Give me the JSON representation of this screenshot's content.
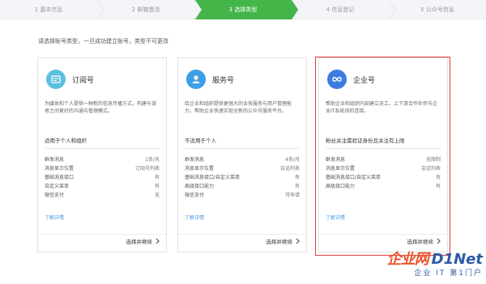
{
  "stepper": {
    "steps": [
      {
        "label": "1 基本信息"
      },
      {
        "label": "2 邮箱激活"
      },
      {
        "label": "3 选择类型"
      },
      {
        "label": "4 信息登记"
      },
      {
        "label": "5 公众号信息"
      }
    ],
    "active_index": 2
  },
  "instruction": "请选择账号类型，一旦成功建立账号，类型不可更改",
  "cards": [
    {
      "title": "订阅号",
      "icon": "subscription-icon",
      "icon_color": "#5bc0de",
      "desc": "为媒体和个人提供一种新的信息传播方式，构建与读者之间更好的沟通与管理模式。",
      "audience": "适用于个人和组织",
      "features": [
        {
          "label": "群发消息",
          "value": "1条/天"
        },
        {
          "label": "消息显示位置",
          "value": "订阅号列表"
        },
        {
          "label": "基础消息接口",
          "value": "有"
        },
        {
          "label": "自定义菜单",
          "value": "有"
        },
        {
          "label": "微信支付",
          "value": "无"
        }
      ],
      "more": "了解详情",
      "select": "选择并继续"
    },
    {
      "title": "服务号",
      "icon": "service-icon",
      "icon_color": "#3f9ee6",
      "desc": "给企业和组织提供更强大的业务服务与用户管理能力，帮助企业快速实现全新的公众号服务平台。",
      "audience": "不适用于个人",
      "features": [
        {
          "label": "群发消息",
          "value": "4条/月"
        },
        {
          "label": "消息显示位置",
          "value": "会话列表"
        },
        {
          "label": "基础消息接口/自定义菜单",
          "value": "有"
        },
        {
          "label": "高级接口能力",
          "value": "有"
        },
        {
          "label": "微信支付",
          "value": "可申请"
        }
      ],
      "more": "了解详情",
      "select": "选择并继续"
    },
    {
      "title": "企业号",
      "icon": "enterprise-icon",
      "icon_color": "#3d7be0",
      "desc": "帮助企业和组织内部建立员工、上下游合作伙伴与企业IT系统间的连接。",
      "audience": "粉丝关注需验证身份且关注有上限",
      "features": [
        {
          "label": "群发消息",
          "value": "无限制"
        },
        {
          "label": "消息显示位置",
          "value": "会话列表"
        },
        {
          "label": "基础消息接口/自定义菜单",
          "value": "有"
        },
        {
          "label": "高级接口能力",
          "value": "有"
        }
      ],
      "more": "了解详情",
      "select": "选择并继续"
    }
  ],
  "watermark": {
    "cn": "企业网",
    "en": "D1Net",
    "sub": "企业 IT 第1门户"
  },
  "colors": {
    "accent": "#44b549",
    "link": "#459ae9",
    "highlight": "#e23a3a"
  }
}
